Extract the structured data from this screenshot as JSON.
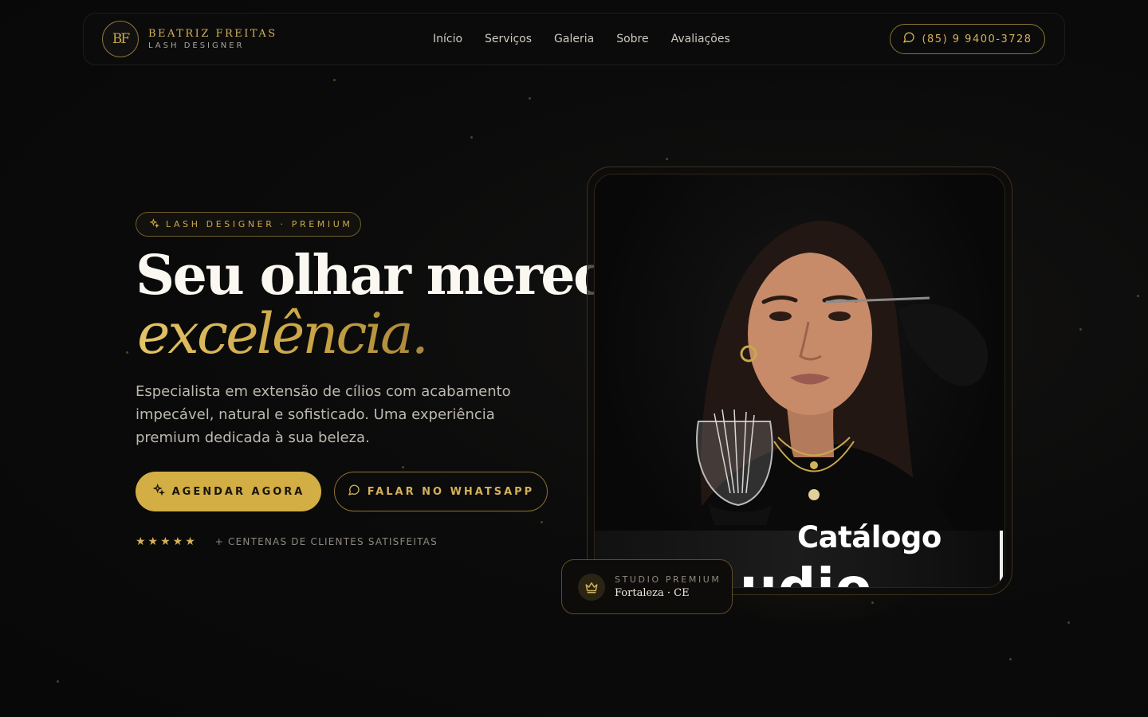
{
  "nav": {
    "brand_name": "BEATRIZ FREITAS",
    "brand_sub": "LASH DESIGNER",
    "logo_initials": "BF",
    "items": [
      {
        "label": "Início"
      },
      {
        "label": "Serviços"
      },
      {
        "label": "Galeria"
      },
      {
        "label": "Sobre"
      },
      {
        "label": "Avaliações"
      }
    ],
    "phone": "(85) 9 9400-3728"
  },
  "hero": {
    "tag": "LASH DESIGNER · PREMIUM",
    "title_line1": "Seu olhar merece",
    "title_line2": "excelência.",
    "lead": "Especialista em extensão de cílios com acabamento impecável, natural e sofisticado. Uma experiência premium dedicada à sua beleza.",
    "cta_primary": "AGENDAR AGORA",
    "cta_secondary": "FALAR NO WHATSAPP",
    "rating_stars": "★★★★★",
    "rating_text": "+ CENTENAS DE CLIENTES SATISFEITAS"
  },
  "photo_card": {
    "catalog_title": "Catálogo",
    "catalog_big": "udio",
    "studio_label": "STUDIO PREMIUM",
    "studio_place": "Fortaleza · CE"
  },
  "colors": {
    "gold": "#d4b15a",
    "background": "#0b0b0b",
    "button_gold": "#d2ae45"
  },
  "icons": [
    "whatsapp-icon",
    "sparkles-icon",
    "star-icon",
    "crown-icon"
  ]
}
